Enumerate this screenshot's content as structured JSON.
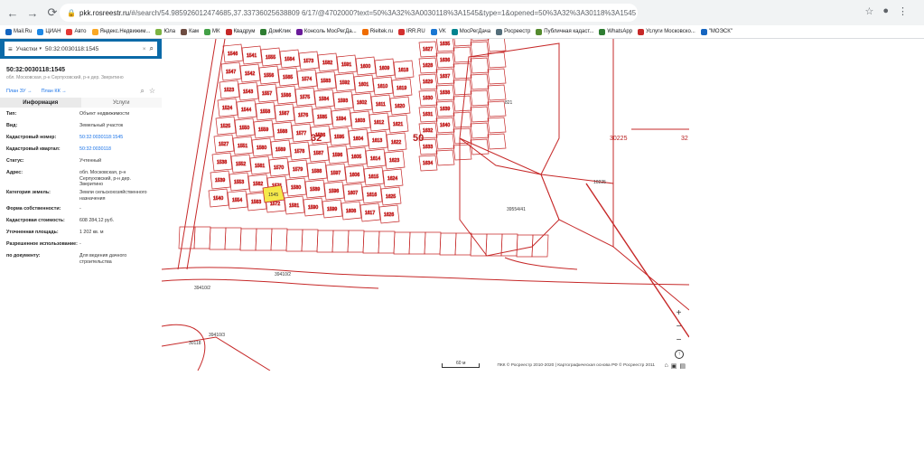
{
  "browser": {
    "url_host": "pkk.rosreestr.ru",
    "url_rest": "/#/search/54.985926012474685,37.33736025638809 6/17/@4702000?text=50%3A32%3A0030118%3A1545&type=1&opened=50%3A32%3A30118%3A1545"
  },
  "bookmarks": [
    {
      "label": "Mail.Ru",
      "color": "#1565c0"
    },
    {
      "label": "ЦИАН",
      "color": "#1e88e5"
    },
    {
      "label": "Авто",
      "color": "#e53935"
    },
    {
      "label": "Яндекс.Недвижим...",
      "color": "#f9a825"
    },
    {
      "label": "Юла",
      "color": "#7cb342"
    },
    {
      "label": "Кам",
      "color": "#6d4c41"
    },
    {
      "label": "МК",
      "color": "#43a047"
    },
    {
      "label": "Квадрум",
      "color": "#c62828"
    },
    {
      "label": "ДомКлик",
      "color": "#2e7d32"
    },
    {
      "label": "Консоль МосРегДа...",
      "color": "#6a1b9a"
    },
    {
      "label": "Rieltek.ru",
      "color": "#ef6c00"
    },
    {
      "label": "IRR.RU",
      "color": "#d32f2f"
    },
    {
      "label": "VK",
      "color": "#1976d2"
    },
    {
      "label": "МосРегДача",
      "color": "#00838f"
    },
    {
      "label": "Росреестр",
      "color": "#546e7a"
    },
    {
      "label": "Публичная кадаст...",
      "color": "#558b2f"
    },
    {
      "label": "WhatsApp",
      "color": "#2e7d32"
    },
    {
      "label": "Услуги Московско...",
      "color": "#c62828"
    },
    {
      "label": "\"МОЭСК\"",
      "color": "#1565c0"
    }
  ],
  "search": {
    "type_label": "Участки",
    "value": "50:32:0030118:1545"
  },
  "object": {
    "title": "50:32:0030118:1545",
    "subtitle": "обл. Московская, р-н Серпуховский, р-н дер. Зверитино",
    "plan_zu": "План ЗУ →",
    "plan_kk": "План КК →"
  },
  "tabs": [
    "Информация",
    "Услуги"
  ],
  "info_rows": [
    {
      "key": "Тип:",
      "value": "Объект недвижимости",
      "link": false
    },
    {
      "key": "Вид:",
      "value": "Земельный участок",
      "link": false
    },
    {
      "key": "Кадастровый номер:",
      "value": "50:32:0030118:1545",
      "link": true
    },
    {
      "key": "Кадастровый квартал:",
      "value": "50:32:0030118",
      "link": true
    },
    {
      "key": "Статус:",
      "value": "Учтенный",
      "link": false
    },
    {
      "key": "Адрес:",
      "value": "обл. Московская, р-н Серпуховский, р-н дер. Зверитино",
      "link": false
    },
    {
      "key": "Категория земель:",
      "value": "Земли сельскохозяйственного назначения",
      "link": false
    },
    {
      "key": "Форма собственности:",
      "value": "-",
      "link": false
    },
    {
      "key": "Кадастровая стоимость:",
      "value": "608 284,12 руб.",
      "link": false
    },
    {
      "key": "Уточненная площадь:",
      "value": "1 202 кв. м",
      "link": false
    },
    {
      "key": "Разрешенное использование:",
      "value": "-",
      "link": false
    },
    {
      "key": "по документу:",
      "value": "Для ведения дачного строительства",
      "link": false
    }
  ],
  "map": {
    "labels_big": [
      "50",
      "32"
    ],
    "labels_mid": [
      "30225",
      "32"
    ],
    "scale_label": "60 м",
    "attribution": "ПКК © Росреестр 2010-2020 | Картографическая основа РФ © Росреестр 2011",
    "parcel_labels": [
      "1545",
      "1546",
      "1547",
      "1523",
      "1524",
      "1525",
      "1527",
      "1538",
      "1539",
      "1540",
      "1541",
      "1542",
      "1543",
      "1544",
      "1550",
      "1551",
      "1552",
      "1553",
      "1554",
      "1555",
      "1556",
      "1557",
      "1558",
      "1559",
      "1560",
      "1561",
      "1562",
      "1563",
      "1564",
      "1565",
      "1566",
      "1567",
      "1568",
      "1569",
      "1570",
      "1571",
      "1572",
      "1573",
      "1574",
      "1575",
      "1576",
      "1577",
      "1578",
      "1579",
      "1580",
      "1581",
      "1582",
      "1583",
      "1584",
      "1585",
      "1586",
      "1587",
      "1588",
      "1589",
      "1590",
      "1591",
      "1592",
      "1593",
      "1594",
      "1595",
      "1596",
      "1597",
      "1598",
      "1599",
      "1600",
      "1601",
      "1602",
      "1603",
      "1604",
      "1605",
      "1606",
      "1607",
      "1608",
      "1609",
      "1610",
      "1611",
      "1612",
      "1613",
      "1614",
      "1615",
      "1616",
      "1617",
      "1618",
      "1619",
      "1620",
      "1621",
      "1622",
      "1623",
      "1624",
      "1625",
      "1626",
      "1627",
      "1628",
      "1629",
      "1630",
      "1631",
      "1632",
      "1633",
      "1634",
      "1635",
      "1636",
      "1637",
      "1638",
      "1639",
      "1640"
    ],
    "area_labels": [
      "821",
      "39554/41",
      "39410/2",
      "39410/2",
      "39410/3",
      "30118",
      "10225"
    ]
  }
}
